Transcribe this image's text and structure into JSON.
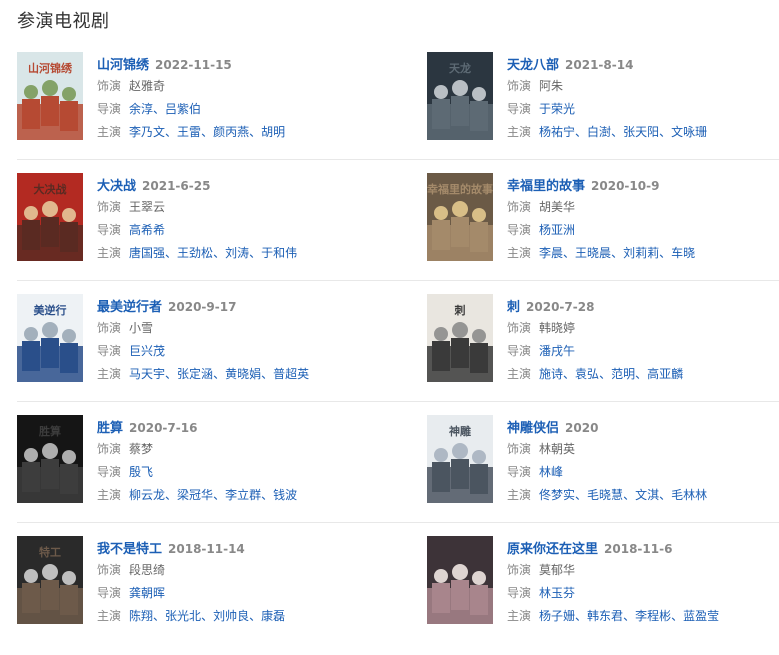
{
  "section_title": "参演电视剧",
  "labels": {
    "role": "饰演",
    "director": "导演",
    "cast": "主演"
  },
  "items": [
    {
      "title": "山河锦绣",
      "date": "2022-11-15",
      "role": "赵雅奇",
      "directors": [
        "余淳",
        "吕紫伯"
      ],
      "cast": [
        "李乃文",
        "王雷",
        "颜丙燕",
        "胡明"
      ],
      "poster_colors": [
        "#d9e6e8",
        "#b64a33",
        "#7a9a5a"
      ],
      "poster_text": "山河锦绣"
    },
    {
      "title": "天龙八部",
      "date": "2021-8-14",
      "role": "阿朱",
      "directors": [
        "于荣光"
      ],
      "cast": [
        "杨祐宁",
        "白澍",
        "张天阳",
        "文咏珊"
      ],
      "poster_colors": [
        "#2b3640",
        "#5d6a74",
        "#c9ced3"
      ],
      "poster_text": "天龙"
    },
    {
      "title": "大决战",
      "date": "2021-6-25",
      "role": "王翠云",
      "directors": [
        "高希希"
      ],
      "cast": [
        "唐国强",
        "王劲松",
        "刘涛",
        "于和伟"
      ],
      "poster_colors": [
        "#b32a22",
        "#5a2a22",
        "#e6c89a"
      ],
      "poster_text": "大决战"
    },
    {
      "title": "幸福里的故事",
      "date": "2020-10-9",
      "role": "胡美华",
      "directors": [
        "杨亚洲"
      ],
      "cast": [
        "李晨",
        "王晓晨",
        "刘莉莉",
        "车晓"
      ],
      "poster_colors": [
        "#6b5a46",
        "#a48a6a",
        "#e4c98e"
      ],
      "poster_text": "幸福里的故事"
    },
    {
      "title": "最美逆行者",
      "date": "2020-9-17",
      "role": "小雪",
      "directors": [
        "巨兴茂"
      ],
      "cast": [
        "马天宇",
        "张定涵",
        "黄晓娟",
        "普超英"
      ],
      "poster_colors": [
        "#eef2f5",
        "#2a4f8a",
        "#9aa8b6"
      ],
      "poster_text": "美逆行"
    },
    {
      "title": "刺",
      "date": "2020-7-28",
      "role": "韩晓婷",
      "directors": [
        "潘戌午"
      ],
      "cast": [
        "施诗",
        "袁弘",
        "范明",
        "高亚麟"
      ],
      "poster_colors": [
        "#e9e6e0",
        "#3a3a3a",
        "#8c8c8c"
      ],
      "poster_text": "刺"
    },
    {
      "title": "胜算",
      "date": "2020-7-16",
      "role": "蔡梦",
      "directors": [
        "殷飞"
      ],
      "cast": [
        "柳云龙",
        "梁冠华",
        "李立群",
        "钱波"
      ],
      "poster_colors": [
        "#151515",
        "#3d3d3d",
        "#bfbfbf"
      ],
      "poster_text": "胜算"
    },
    {
      "title": "神雕侠侣",
      "date": "2020",
      "role": "林朝英",
      "directors": [
        "林峰"
      ],
      "cast": [
        "佟梦实",
        "毛晓慧",
        "文淇",
        "毛林林"
      ],
      "poster_colors": [
        "#e8ecef",
        "#4b5560",
        "#a7b3bf"
      ],
      "poster_text": "神雕"
    },
    {
      "title": "我不是特工",
      "date": "2018-11-14",
      "role": "段思绮",
      "directors": [
        "龚朝晖"
      ],
      "cast": [
        "陈翔",
        "张光北",
        "刘帅良",
        "康磊"
      ],
      "poster_colors": [
        "#2a2a2a",
        "#6d5a4a",
        "#cfcfcf"
      ],
      "poster_text": "特工"
    },
    {
      "title": "原来你还在这里",
      "date": "2018-11-6",
      "role": "莫郁华",
      "directors": [
        "林玉芬"
      ],
      "cast": [
        "杨子姗",
        "韩东君",
        "李程彬",
        "蓝盈莹"
      ],
      "poster_colors": [
        "#3d3338",
        "#a8858c",
        "#efe6e2"
      ],
      "poster_text": ""
    }
  ]
}
